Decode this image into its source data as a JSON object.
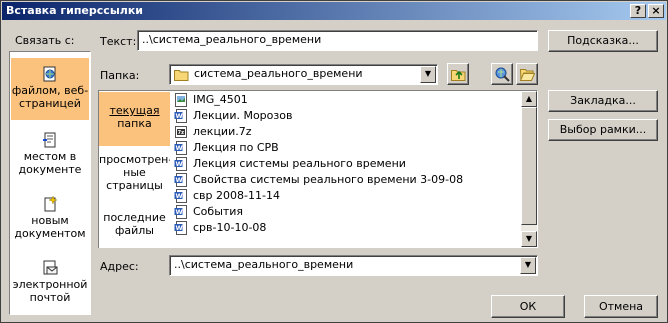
{
  "window": {
    "title": "Вставка гиперссылки",
    "help_glyph": "?",
    "close_glyph": "×"
  },
  "link_to": {
    "label": "Связать с:",
    "items": [
      {
        "line1": "файлом, веб-",
        "line2": "страницей",
        "icon": "web-page-icon",
        "selected": true
      },
      {
        "line1": "местом в",
        "line2": "документе",
        "icon": "place-in-document-icon",
        "selected": false
      },
      {
        "line1": "новым",
        "line2": "документом",
        "icon": "new-document-icon",
        "selected": false
      },
      {
        "line1": "электронной",
        "line2": "почтой",
        "icon": "email-icon",
        "selected": false
      }
    ]
  },
  "text_field": {
    "label": "Текст:",
    "value": "..\\система_реального_времени"
  },
  "screentip_button": "Подсказка...",
  "folder": {
    "label": "Папка:",
    "value": "система_реального_времени"
  },
  "places": {
    "items": [
      {
        "lines": [
          "текущая",
          "папка"
        ],
        "selected": true
      },
      {
        "lines": [
          "просмотрен-",
          "ные",
          "страницы"
        ],
        "selected": false
      },
      {
        "lines": [
          "последние",
          "файлы"
        ],
        "selected": false
      }
    ]
  },
  "files": [
    {
      "name": "IMG_4501",
      "icon": "image-file-icon"
    },
    {
      "name": "Лекции. Морозов",
      "icon": "word-document-icon"
    },
    {
      "name": "лекции.7z",
      "icon": "archive-file-icon"
    },
    {
      "name": "Лекция по СРВ",
      "icon": "word-document-icon"
    },
    {
      "name": "Лекция системы реального времени",
      "icon": "word-document-icon"
    },
    {
      "name": "Свойства системы реального времени 3-09-08",
      "icon": "word-document-icon"
    },
    {
      "name": "свр 2008-11-14",
      "icon": "word-document-icon"
    },
    {
      "name": "События",
      "icon": "word-document-icon"
    },
    {
      "name": "срв-10-10-08",
      "icon": "word-document-icon"
    }
  ],
  "bookmark_button": "Закладка...",
  "target_frame_button": "Выбор рамки...",
  "address": {
    "label": "Адрес:",
    "value": "..\\система_реального_времени"
  },
  "ok_button": "ОК",
  "cancel_button": "Отмена",
  "colors": {
    "title_start": "#0a246a",
    "title_end": "#a6caf0",
    "selection": "#fbc27d",
    "face": "#d4d0c8"
  }
}
